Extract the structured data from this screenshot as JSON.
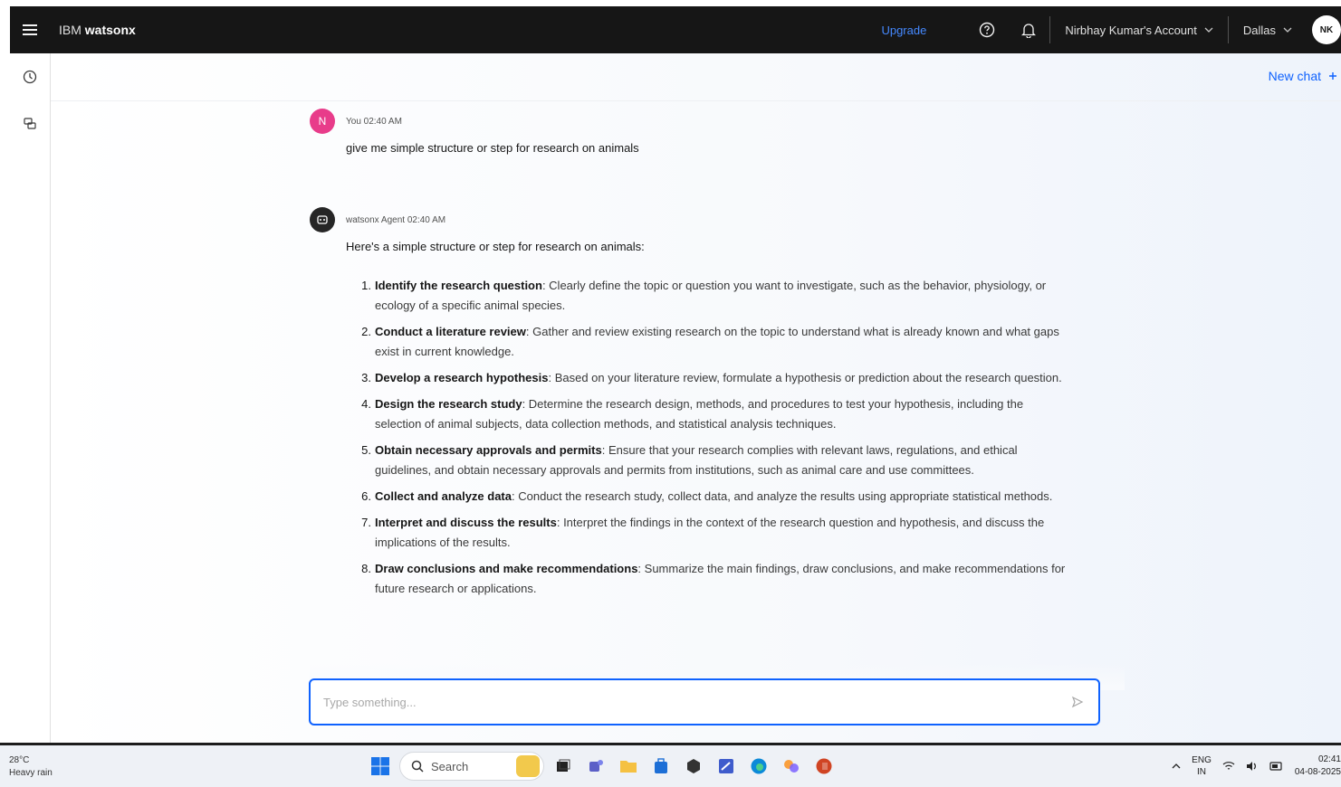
{
  "header": {
    "brand_light": "IBM",
    "brand_bold": "watsonx",
    "upgrade": "Upgrade",
    "account": "Nirbhay Kumar's Account",
    "region": "Dallas",
    "avatar_initials": "NK"
  },
  "toolbar": {
    "new_chat": "New chat"
  },
  "user_message": {
    "avatar": "N",
    "meta": "You 02:40 AM",
    "text": "give me simple structure or step for research on animals"
  },
  "agent_message": {
    "meta": "watsonx Agent 02:40 AM",
    "intro": "Here's a simple structure or step for research on animals:",
    "steps": [
      {
        "num": "1.",
        "title": "Identify the research question",
        "desc": ": Clearly define the topic or question you want to investigate, such as the behavior, physiology, or ecology of a specific animal species."
      },
      {
        "num": "2.",
        "title": "Conduct a literature review",
        "desc": ": Gather and review existing research on the topic to understand what is already known and what gaps exist in current knowledge."
      },
      {
        "num": "3.",
        "title": "Develop a research hypothesis",
        "desc": ": Based on your literature review, formulate a hypothesis or prediction about the research question."
      },
      {
        "num": "4.",
        "title": "Design the research study",
        "desc": ": Determine the research design, methods, and procedures to test your hypothesis, including the selection of animal subjects, data collection methods, and statistical analysis techniques."
      },
      {
        "num": "5.",
        "title": "Obtain necessary approvals and permits",
        "desc": ": Ensure that your research complies with relevant laws, regulations, and ethical guidelines, and obtain necessary approvals and permits from institutions, such as animal care and use committees."
      },
      {
        "num": "6.",
        "title": "Collect and analyze data",
        "desc": ": Conduct the research study, collect data, and analyze the results using appropriate statistical methods."
      },
      {
        "num": "7.",
        "title": "Interpret and discuss the results",
        "desc": ": Interpret the findings in the context of the research question and hypothesis, and discuss the implications of the results."
      },
      {
        "num": "8.",
        "title": "Draw conclusions and make recommendations",
        "desc": ": Summarize the main findings, draw conclusions, and make recommendations for future research or applications."
      }
    ]
  },
  "composer": {
    "placeholder": "Type something..."
  },
  "taskbar": {
    "weather_temp": "28°C",
    "weather_desc": "Heavy rain",
    "search": "Search",
    "lang_top": "ENG",
    "lang_bottom": "IN",
    "time": "02:41",
    "date": "04-08-2025"
  }
}
